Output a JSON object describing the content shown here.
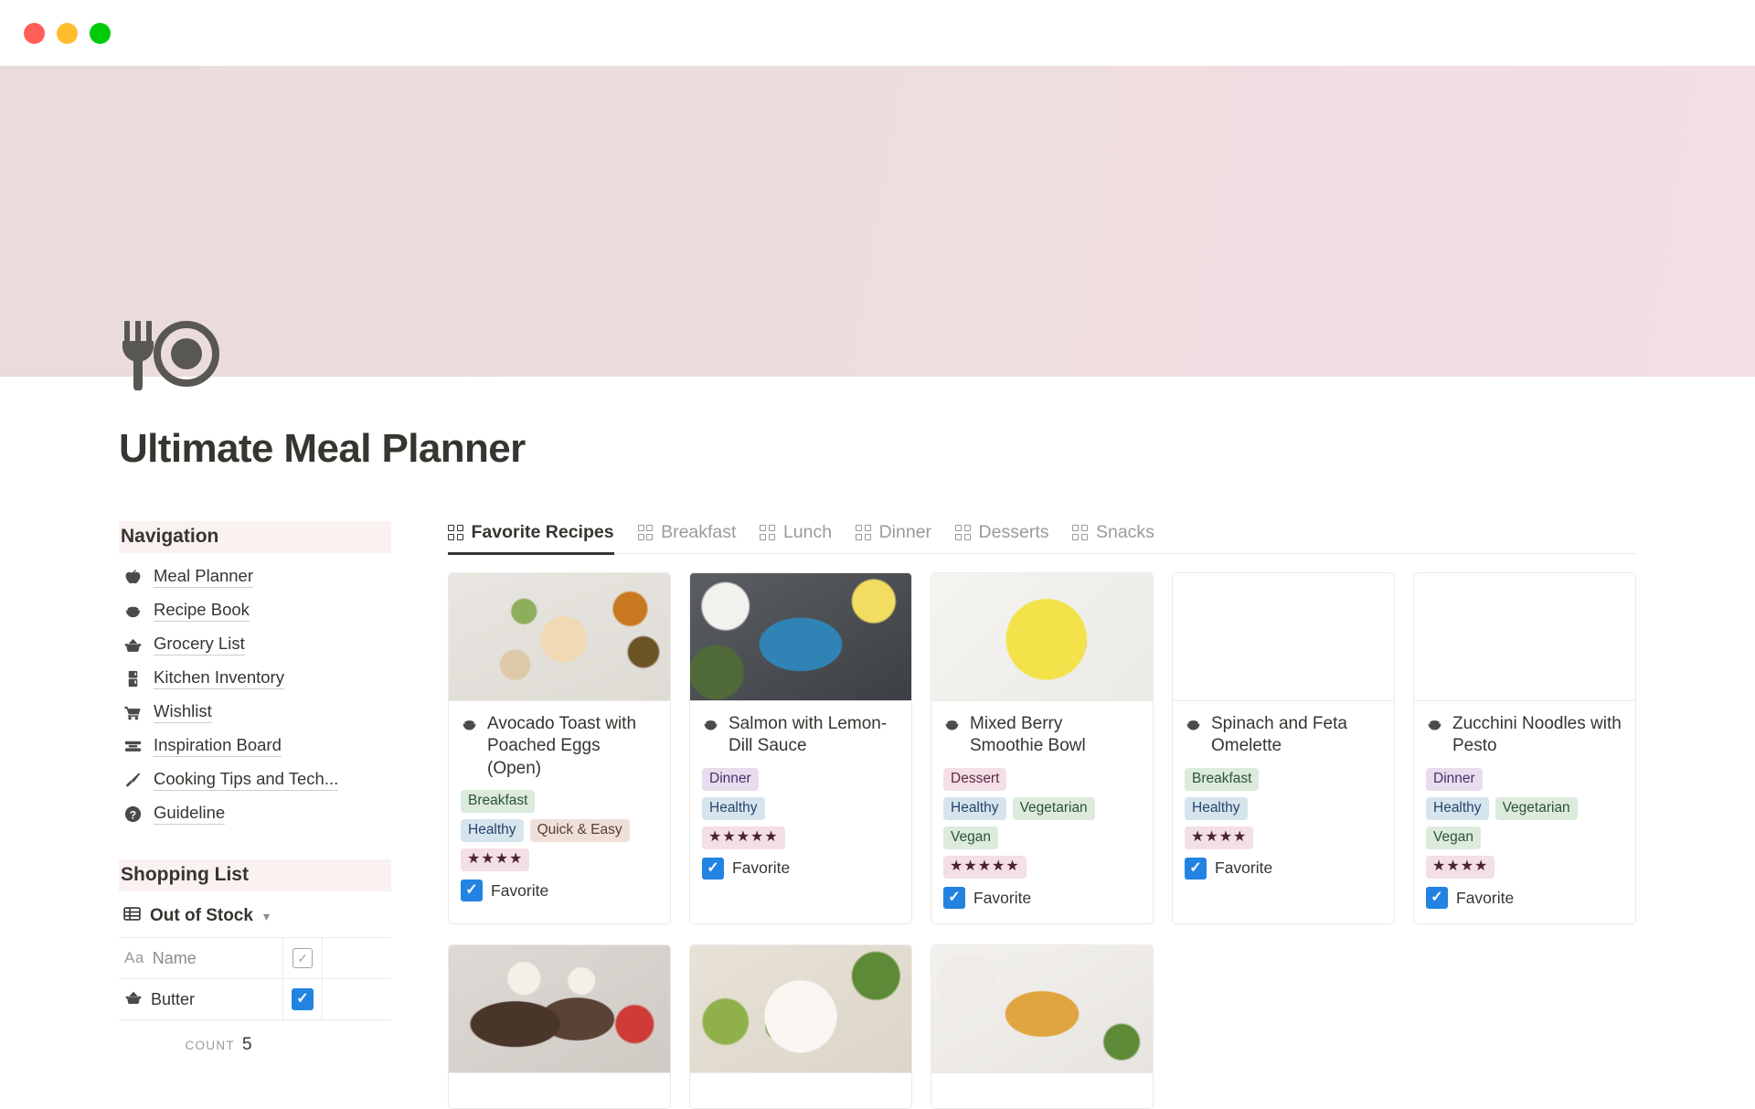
{
  "window": {
    "buttons": [
      {
        "name": "close",
        "color": "#ff5f57"
      },
      {
        "name": "minimize",
        "color": "#ffbd2e"
      },
      {
        "name": "maximize",
        "color": "#00ca0a"
      }
    ]
  },
  "page": {
    "icon": "fork-and-plate-icon",
    "title": "Ultimate Meal Planner",
    "cover_colors": [
      "#eadcdb",
      "#f4dde4"
    ]
  },
  "sidebar": {
    "navigation": {
      "heading": "Navigation",
      "items": [
        {
          "label": "Meal Planner",
          "icon": "apple-icon"
        },
        {
          "label": "Recipe Book",
          "icon": "bowl-icon"
        },
        {
          "label": "Grocery List",
          "icon": "basket-icon"
        },
        {
          "label": "Kitchen Inventory",
          "icon": "fridge-icon"
        },
        {
          "label": "Wishlist",
          "icon": "shopping-cart-icon"
        },
        {
          "label": "Inspiration Board",
          "icon": "stacked-layers-icon"
        },
        {
          "label": "Cooking Tips and Tech...",
          "icon": "knife-icon"
        },
        {
          "label": "Guideline",
          "icon": "question-mark-icon"
        }
      ]
    },
    "shopping_list": {
      "heading": "Shopping List",
      "view_name": "Out of Stock",
      "view_icon": "table-icon",
      "chevron": "chevron-down-icon",
      "columns": [
        {
          "type_label": "Aa",
          "label": "Name"
        },
        {
          "label": "",
          "icon": "checkbox-icon"
        }
      ],
      "rows": [
        {
          "icon": "basket-icon",
          "name": "Butter",
          "checked": true
        }
      ],
      "count_label": "COUNT",
      "count_value": "5"
    }
  },
  "main": {
    "tabs": [
      {
        "label": "Favorite Recipes",
        "icon": "gallery-view-icon",
        "active": true
      },
      {
        "label": "Breakfast",
        "icon": "gallery-view-icon",
        "active": false
      },
      {
        "label": "Lunch",
        "icon": "gallery-view-icon",
        "active": false
      },
      {
        "label": "Dinner",
        "icon": "gallery-view-icon",
        "active": false
      },
      {
        "label": "Desserts",
        "icon": "gallery-view-icon",
        "active": false
      },
      {
        "label": "Snacks",
        "icon": "gallery-view-icon",
        "active": false
      }
    ],
    "cards": [
      {
        "title": "Avocado Toast with Poached Eggs (Open)",
        "icon": "bowl-icon",
        "image": "avocado-toast-photo",
        "tag_rows": [
          [
            {
              "label": "Breakfast",
              "color": "green"
            }
          ],
          [
            {
              "label": "Healthy",
              "color": "blue"
            },
            {
              "label": "Quick & Easy",
              "color": "brown"
            }
          ]
        ],
        "rating": 4,
        "rating_stars": "★★★★",
        "favorite_label": "Favorite",
        "favorite": true
      },
      {
        "title": "Salmon with Lemon-Dill Sauce",
        "icon": "bowl-icon",
        "image": "salmon-photo",
        "tag_rows": [
          [
            {
              "label": "Dinner",
              "color": "purple"
            }
          ],
          [
            {
              "label": "Healthy",
              "color": "blue"
            }
          ]
        ],
        "rating": 5,
        "rating_stars": "★★★★★",
        "favorite_label": "Favorite",
        "favorite": true
      },
      {
        "title": "Mixed Berry Smoothie Bowl",
        "icon": "bowl-icon",
        "image": "berry-smoothie-bowl-photo",
        "tag_rows": [
          [
            {
              "label": "Dessert",
              "color": "pink"
            }
          ],
          [
            {
              "label": "Healthy",
              "color": "blue"
            },
            {
              "label": "Vegetarian",
              "color": "green"
            }
          ],
          [
            {
              "label": "Vegan",
              "color": "green"
            }
          ]
        ],
        "rating": 5,
        "rating_stars": "★★★★★",
        "favorite_label": "Favorite",
        "favorite": true
      },
      {
        "title": "Spinach and Feta Omelette",
        "icon": "bowl-icon",
        "image": "empty-placeholder",
        "tag_rows": [
          [
            {
              "label": "Breakfast",
              "color": "green"
            }
          ],
          [
            {
              "label": "Healthy",
              "color": "blue"
            }
          ]
        ],
        "rating": 4,
        "rating_stars": "★★★★",
        "favorite_label": "Favorite",
        "favorite": true
      },
      {
        "title": "Zucchini Noodles with Pesto",
        "icon": "bowl-icon",
        "image": "empty-placeholder",
        "tag_rows": [
          [
            {
              "label": "Dinner",
              "color": "purple"
            }
          ],
          [
            {
              "label": "Healthy",
              "color": "blue"
            },
            {
              "label": "Vegetarian",
              "color": "green"
            }
          ],
          [
            {
              "label": "Vegan",
              "color": "green"
            }
          ]
        ],
        "rating": 4,
        "rating_stars": "★★★★",
        "favorite_label": "Favorite",
        "favorite": true
      }
    ],
    "second_row_cards": [
      {
        "image": "chocolate-chia-pudding-photo"
      },
      {
        "image": "burrito-bowl-photo"
      },
      {
        "image": "roasted-chickpeas-photo"
      }
    ]
  }
}
